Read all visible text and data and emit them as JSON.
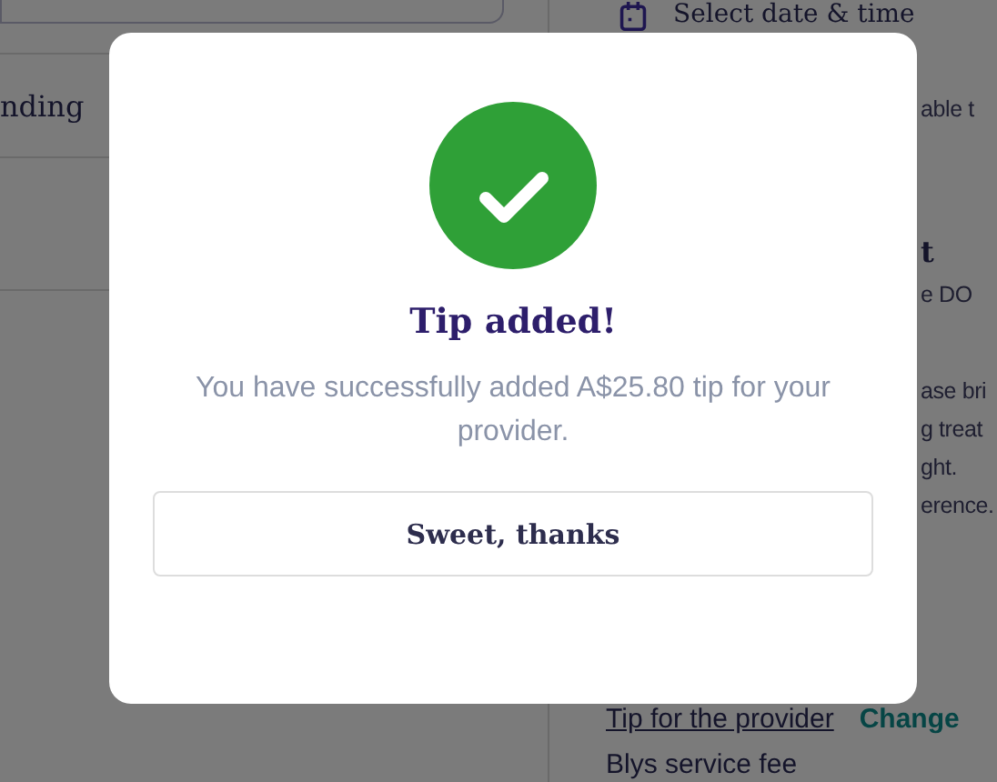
{
  "background": {
    "left": {
      "row_label": "nding"
    },
    "right": {
      "step_label": "Select date & time",
      "fragments": [
        {
          "text": "able t",
          "kind": "plain"
        },
        {
          "text": "t",
          "kind": "heading"
        },
        {
          "text": "e DO",
          "kind": "plain"
        },
        {
          "text": "ase bri",
          "kind": "plain"
        },
        {
          "text": "g treat",
          "kind": "plain"
        },
        {
          "text": "ght.",
          "kind": "plain"
        },
        {
          "text": "erence.",
          "kind": "plain"
        }
      ],
      "tip_label": "Tip for the provider",
      "change_link": "Change",
      "fee_label": "Blys service fee"
    }
  },
  "modal": {
    "title": "Tip added!",
    "message": "You have successfully added A$25.80 tip for your provider.",
    "button": "Sweet, thanks"
  }
}
